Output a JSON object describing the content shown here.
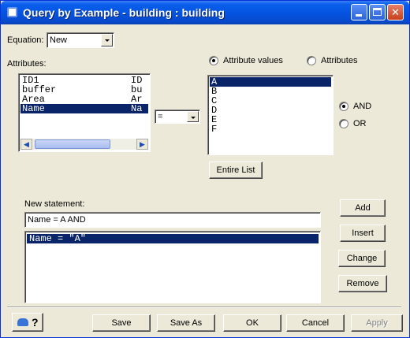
{
  "window": {
    "title": "Query by Example - building : building"
  },
  "equation": {
    "label": "Equation:",
    "value": "New"
  },
  "attributes": {
    "label": "Attributes:",
    "rows": [
      {
        "name": "ID1",
        "abbr": "ID"
      },
      {
        "name": "buffer",
        "abbr": "bu"
      },
      {
        "name": "Area",
        "abbr": "Ar"
      },
      {
        "name": "Name",
        "abbr": "Na"
      }
    ],
    "selected_index": 3
  },
  "operator": {
    "value": "="
  },
  "value_mode": {
    "attribute_values_label": "Attribute values",
    "attributes_label": "Attributes",
    "selected": "Attribute values"
  },
  "values": {
    "items": [
      "A",
      "B",
      "C",
      "D",
      "E",
      "F"
    ],
    "selected": "A"
  },
  "logic": {
    "and_label": "AND",
    "or_label": "OR",
    "selected": "AND"
  },
  "entire_list_label": "Entire List",
  "new_statement": {
    "label": "New statement:",
    "value": "Name = A AND"
  },
  "statements": {
    "items": [
      "Name = \"A\""
    ],
    "selected_index": 0
  },
  "side_buttons": {
    "add": "Add",
    "insert": "Insert",
    "change": "Change",
    "remove": "Remove"
  },
  "bottom_buttons": {
    "save": "Save",
    "save_as": "Save As",
    "ok": "OK",
    "cancel": "Cancel",
    "apply": "Apply"
  },
  "help_icon_text": "?"
}
